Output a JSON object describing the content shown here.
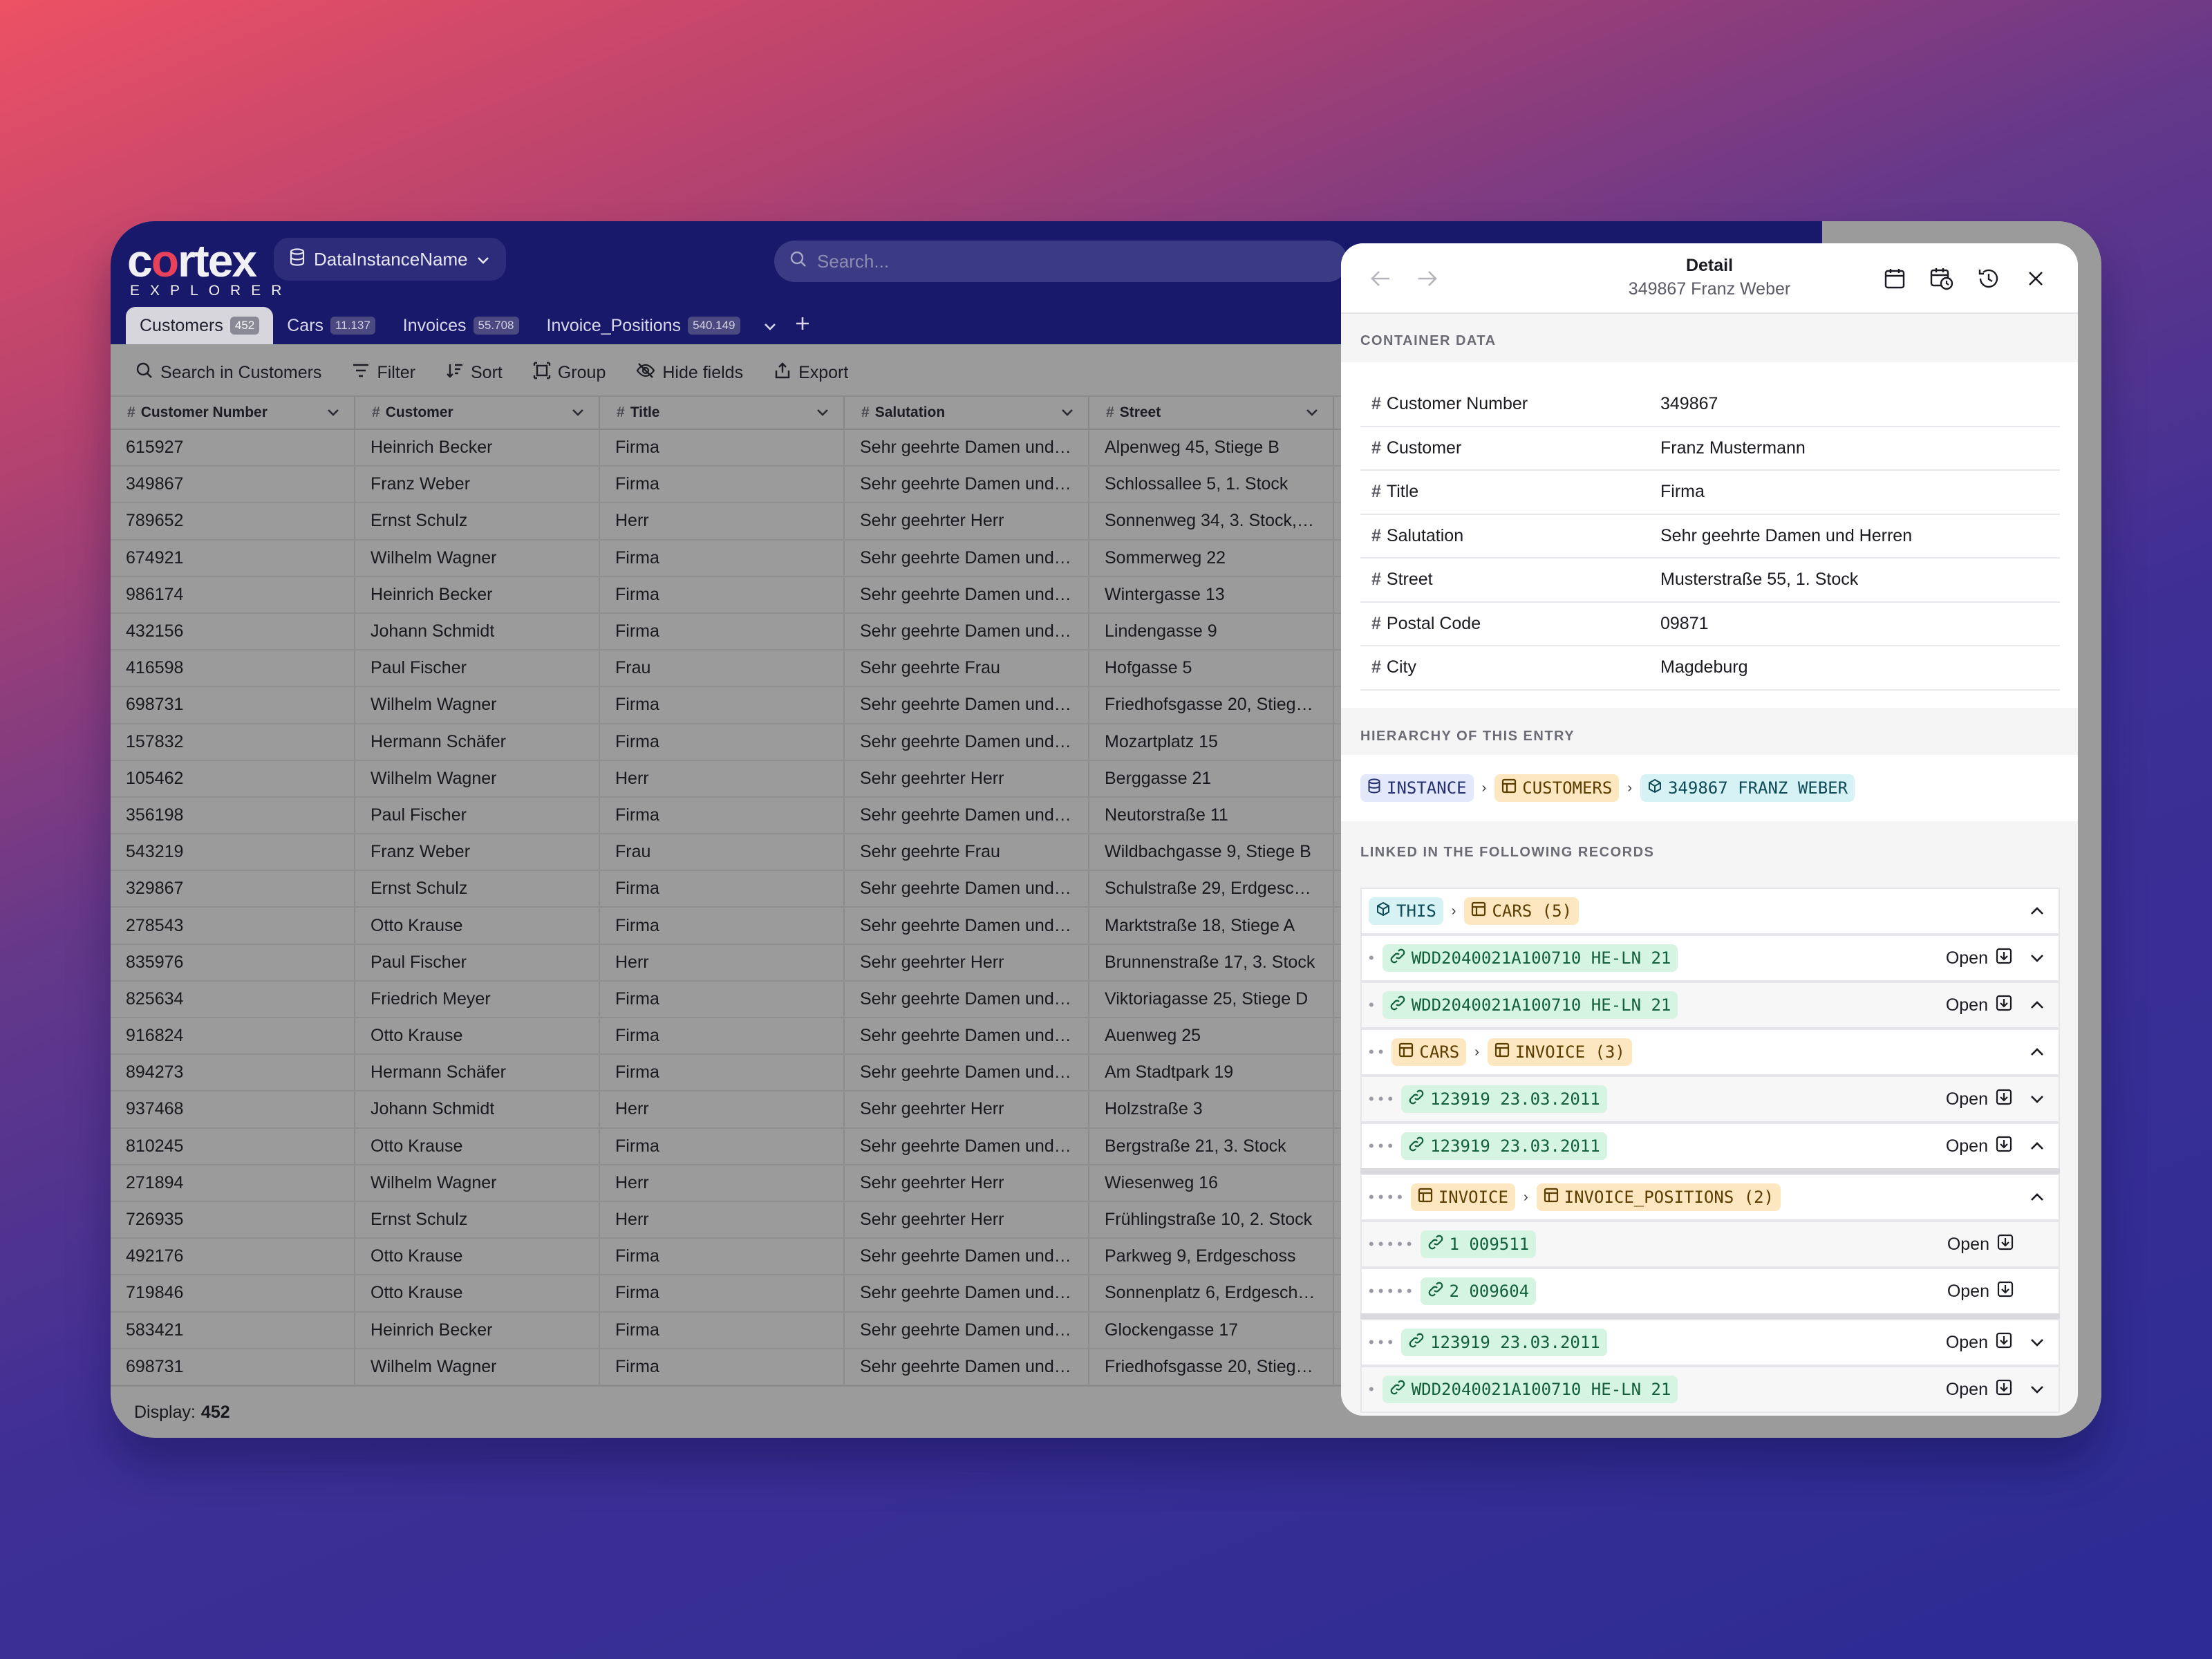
{
  "app": {
    "logo_word_start": "c",
    "logo_word_o": "o",
    "logo_word_end": "rtex",
    "logo_sub": "EXPLORER",
    "instance_name": "DataInstanceName",
    "search_placeholder": "Search..."
  },
  "tabs": [
    {
      "label": "Customers",
      "count": "452",
      "active": true
    },
    {
      "label": "Cars",
      "count": "11.137"
    },
    {
      "label": "Invoices",
      "count": "55.708"
    },
    {
      "label": "Invoice_Positions",
      "count": "540.149"
    }
  ],
  "toolbar": {
    "search": "Search in Customers",
    "filter": "Filter",
    "sort": "Sort",
    "group": "Group",
    "hide": "Hide fields",
    "export": "Export"
  },
  "table": {
    "columns": [
      "Customer Number",
      "Customer",
      "Title",
      "Salutation",
      "Street"
    ],
    "rows": [
      [
        "615927",
        "Heinrich Becker",
        "Firma",
        "Sehr geehrte Damen und…",
        "Alpenweg 45, Stiege B"
      ],
      [
        "349867",
        "Franz Weber",
        "Firma",
        "Sehr geehrte Damen und…",
        "Schlossallee 5, 1. Stock"
      ],
      [
        "789652",
        "Ernst Schulz",
        "Herr",
        "Sehr geehrter Herr",
        "Sonnenweg 34, 3. Stock,…"
      ],
      [
        "674921",
        "Wilhelm Wagner",
        "Firma",
        "Sehr geehrte Damen und…",
        "Sommerweg 22"
      ],
      [
        "986174",
        "Heinrich Becker",
        "Firma",
        "Sehr geehrte Damen und…",
        "Wintergasse 13"
      ],
      [
        "432156",
        "Johann Schmidt",
        "Firma",
        "Sehr geehrte Damen und…",
        "Lindengasse 9"
      ],
      [
        "416598",
        "Paul Fischer",
        "Frau",
        "Sehr geehrte Frau",
        "Hofgasse 5"
      ],
      [
        "698731",
        "Wilhelm Wagner",
        "Firma",
        "Sehr geehrte Damen und…",
        "Friedhofsgasse 20, Stiege…"
      ],
      [
        "157832",
        "Hermann Schäfer",
        "Firma",
        "Sehr geehrte Damen und…",
        "Mozartplatz 15"
      ],
      [
        "105462",
        "Wilhelm Wagner",
        "Herr",
        "Sehr geehrter Herr",
        "Berggasse 21"
      ],
      [
        "356198",
        "Paul Fischer",
        "Firma",
        "Sehr geehrte Damen und…",
        "Neutorstraße 11"
      ],
      [
        "543219",
        "Franz Weber",
        "Frau",
        "Sehr geehrte Frau",
        "Wildbachgasse 9, Stiege B"
      ],
      [
        "329867",
        "Ernst Schulz",
        "Firma",
        "Sehr geehrte Damen und…",
        "Schulstraße 29, Erdgesch…"
      ],
      [
        "278543",
        "Otto Krause",
        "Firma",
        "Sehr geehrte Damen und…",
        "Marktstraße 18, Stiege A"
      ],
      [
        "835976",
        "Paul Fischer",
        "Herr",
        "Sehr geehrter Herr",
        "Brunnenstraße 17, 3. Stock"
      ],
      [
        "825634",
        "Friedrich Meyer",
        "Firma",
        "Sehr geehrte Damen und…",
        "Viktoriagasse 25, Stiege D"
      ],
      [
        "916824",
        "Otto Krause",
        "Firma",
        "Sehr geehrte Damen und…",
        "Auenweg 25"
      ],
      [
        "894273",
        "Hermann Schäfer",
        "Firma",
        "Sehr geehrte Damen und…",
        "Am Stadtpark 19"
      ],
      [
        "937468",
        "Johann Schmidt",
        "Herr",
        "Sehr geehrter Herr",
        "Holzstraße 3"
      ],
      [
        "810245",
        "Otto Krause",
        "Firma",
        "Sehr geehrte Damen und…",
        "Bergstraße 21, 3. Stock"
      ],
      [
        "271894",
        "Wilhelm Wagner",
        "Herr",
        "Sehr geehrter Herr",
        "Wiesenweg 16"
      ],
      [
        "726935",
        "Ernst Schulz",
        "Herr",
        "Sehr geehrter Herr",
        "Frühlingstraße 10, 2. Stock"
      ],
      [
        "492176",
        "Otto Krause",
        "Firma",
        "Sehr geehrte Damen und…",
        "Parkweg 9, Erdgeschoss"
      ],
      [
        "719846",
        "Otto Krause",
        "Firma",
        "Sehr geehrte Damen und…",
        "Sonnenplatz 6, Erdgescho…"
      ],
      [
        "583421",
        "Heinrich Becker",
        "Firma",
        "Sehr geehrte Damen und…",
        "Glockengasse 17"
      ],
      [
        "698731",
        "Wilhelm Wagner",
        "Firma",
        "Sehr geehrte Damen und…",
        "Friedhofsgasse 20, Stiege…"
      ]
    ]
  },
  "footer": {
    "label": "Display:",
    "count": "452"
  },
  "detail": {
    "title": "Detail",
    "subtitle": "349867 Franz Weber",
    "section_container": "CONTAINER DATA",
    "fields": [
      {
        "key": "Customer Number",
        "value": "349867"
      },
      {
        "key": "Customer",
        "value": "Franz Mustermann"
      },
      {
        "key": "Title",
        "value": "Firma"
      },
      {
        "key": "Salutation",
        "value": "Sehr geehrte Damen und Herren"
      },
      {
        "key": "Street",
        "value": "Musterstraße 55, 1. Stock"
      },
      {
        "key": "Postal Code",
        "value": "09871"
      },
      {
        "key": "City",
        "value": "Magdeburg"
      }
    ],
    "section_hierarchy": "HIERARCHY OF THIS ENTRY",
    "hierarchy": [
      "INSTANCE",
      "CUSTOMERS",
      "349867 FRANZ WEBER"
    ],
    "section_linked": "LINKED IN THE FOLLOWING RECORDS",
    "open_label": "Open",
    "linked": [
      {
        "type": "group",
        "dots": 0,
        "chips": [
          {
            "t": "THIS",
            "c": "cy",
            "i": "box"
          },
          {
            "t": "CARS (5)",
            "c": "or",
            "i": "table"
          }
        ],
        "chev": "up"
      },
      {
        "type": "item",
        "dots": 1,
        "chip": "WDD2040021A100710 HE-LN 21",
        "chev": "down"
      },
      {
        "type": "item",
        "dots": 1,
        "chip": "WDD2040021A100710 HE-LN 21",
        "chev": "up"
      },
      {
        "type": "group",
        "dots": 2,
        "chips": [
          {
            "t": "CARS",
            "c": "or",
            "i": "table"
          },
          {
            "t": "INVOICE (3)",
            "c": "or",
            "i": "table"
          }
        ],
        "chev": "up"
      },
      {
        "type": "item",
        "dots": 3,
        "chip": "123919 23.03.2011",
        "chev": "down"
      },
      {
        "type": "item",
        "dots": 3,
        "chip": "123919 23.03.2011",
        "chev": "up"
      },
      {
        "type": "sep"
      },
      {
        "type": "group",
        "dots": 4,
        "chips": [
          {
            "t": "INVOICE",
            "c": "or",
            "i": "table"
          },
          {
            "t": "INVOICE_POSITIONS (2)",
            "c": "or",
            "i": "table"
          }
        ],
        "chev": "up"
      },
      {
        "type": "item",
        "dots": 5,
        "chip": "1 009511",
        "chev": "none"
      },
      {
        "type": "item",
        "dots": 5,
        "chip": "2 009604",
        "chev": "none"
      },
      {
        "type": "sep"
      },
      {
        "type": "item",
        "dots": 3,
        "chip": "123919 23.03.2011",
        "chev": "down"
      },
      {
        "type": "item",
        "dots": 1,
        "chip": "WDD2040021A100710 HE-LN 21",
        "chev": "down"
      }
    ]
  }
}
